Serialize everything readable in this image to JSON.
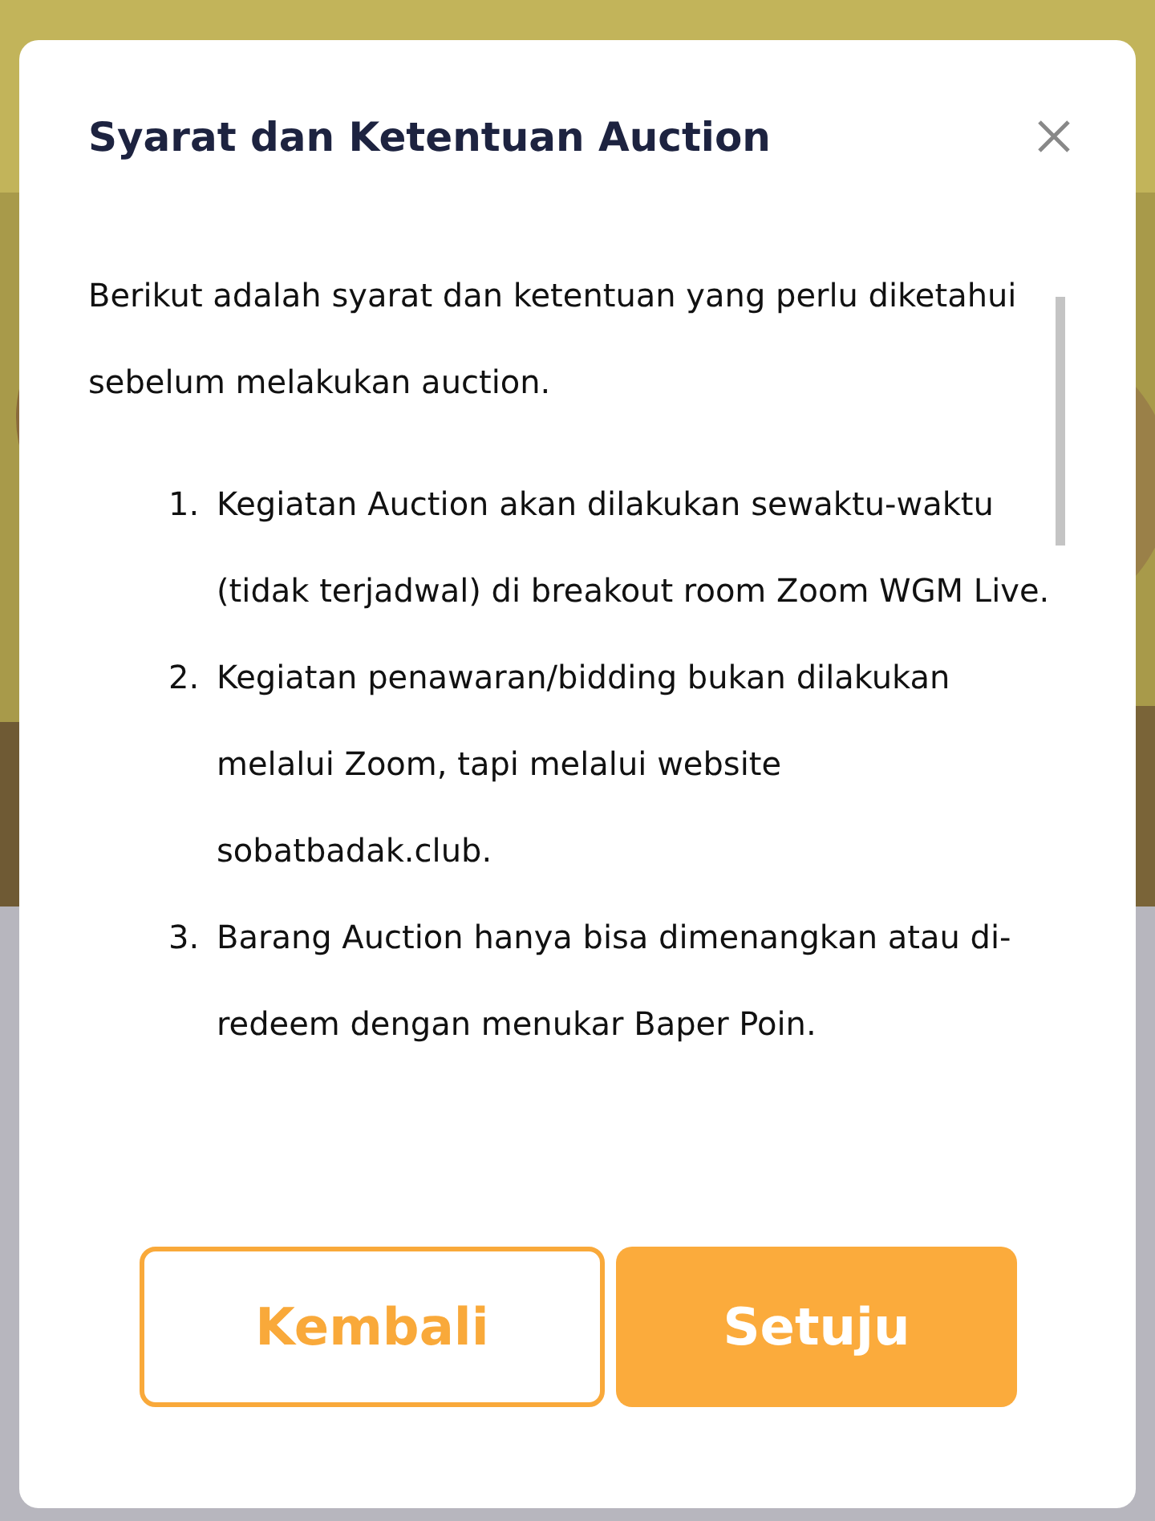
{
  "dialog": {
    "title": "Syarat dan Ketentuan Auction",
    "intro": "Berikut adalah syarat dan ketentuan yang perlu diketahui sebelum melakukan auction.",
    "terms": [
      {
        "number": "1.",
        "text": "Kegiatan Auction akan dilakukan sewaktu-waktu (tidak terjadwal) di breakout room Zoom WGM Live."
      },
      {
        "number": "2.",
        "text": "Kegiatan penawaran/bidding bukan dilakukan melalui Zoom, tapi melalui website sobatbadak.club."
      },
      {
        "number": "3.",
        "text": "Barang Auction hanya bisa dimenangkan atau di-redeem dengan menukar Baper Poin."
      }
    ],
    "buttons": [
      {
        "label": "Kembali",
        "kind": "outline"
      },
      {
        "label": "Setuju",
        "kind": "filled"
      }
    ]
  }
}
